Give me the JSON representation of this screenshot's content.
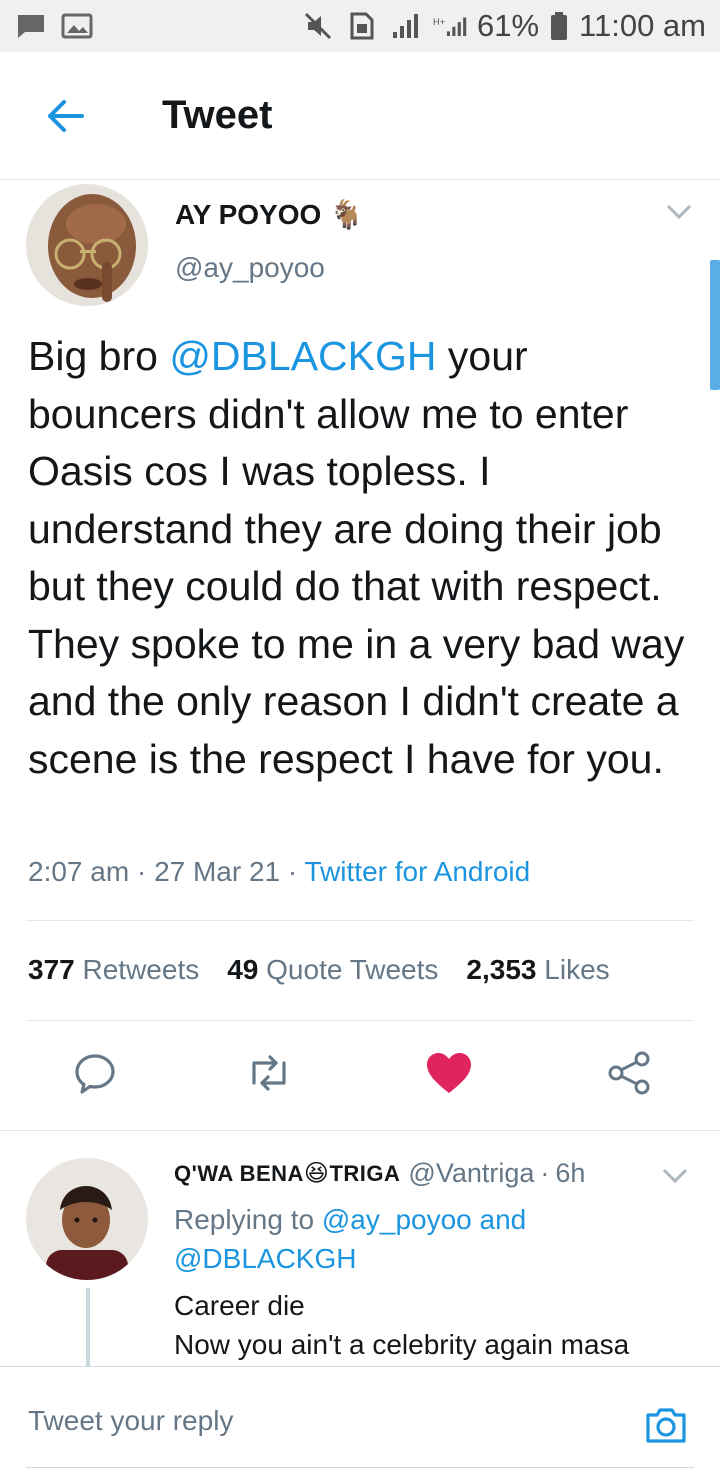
{
  "status_bar": {
    "battery_percent": "61%",
    "time": "11:00 am"
  },
  "header": {
    "title": "Tweet"
  },
  "tweet": {
    "author_name": "AY POYOO",
    "author_emoji": "🐐",
    "author_handle": "@ay_poyoo",
    "text_before_mention": "Big bro ",
    "mention": "@DBLACKGH",
    "text_after_mention": " your bouncers didn't allow me to enter Oasis cos I was topless. I understand they are doing their job but they could do that with respect. They spoke to me in a very bad way and the only reason I didn't create a scene is the respect I have for you.",
    "time": "2:07 am",
    "date": "27 Mar 21",
    "source": "Twitter for Android",
    "retweets_count": "377",
    "retweets_label": "Retweets",
    "quotes_count": "49",
    "quotes_label": "Quote Tweets",
    "likes_count": "2,353",
    "likes_label": "Likes",
    "liked": true
  },
  "reply": {
    "name_part1": "Q'WA BENA",
    "name_emoji": "😆",
    "name_part2": "TRIGA",
    "handle": "@Vantriga",
    "age": "6h",
    "replying_prefix": "Replying to",
    "replying_to_1": "@ay_poyoo",
    "replying_and": "and",
    "replying_to_2": "@DBLACKGH",
    "line1": "Career die",
    "line2": "Now you ain't a celebrity again masa"
  },
  "compose": {
    "placeholder": "Tweet your reply"
  },
  "colors": {
    "accent": "#1b95e0",
    "like": "#e0245e",
    "muted": "#657786",
    "text": "#14171a"
  }
}
